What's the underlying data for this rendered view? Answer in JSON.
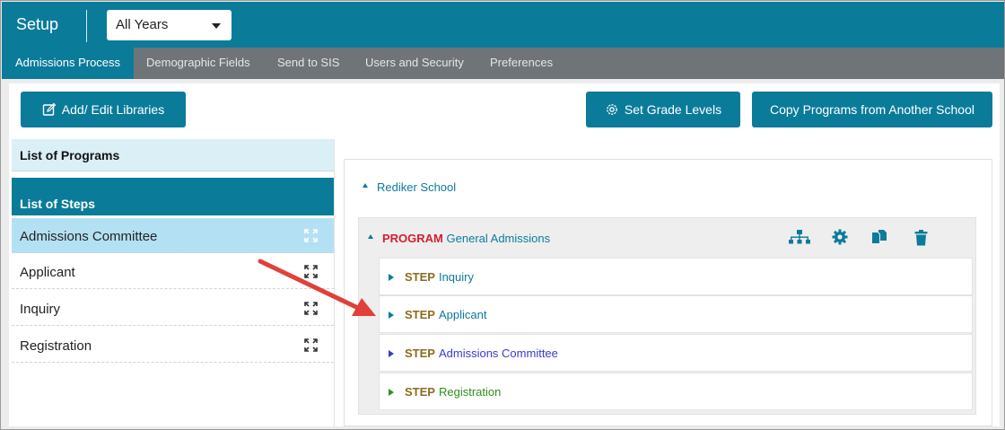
{
  "header": {
    "title": "Setup",
    "year_select": {
      "value": "All Years"
    }
  },
  "tabs": [
    {
      "label": "Admissions Process",
      "active": true
    },
    {
      "label": "Demographic Fields"
    },
    {
      "label": "Send to SIS"
    },
    {
      "label": "Users and Security"
    },
    {
      "label": "Preferences"
    }
  ],
  "toolbar": {
    "add_edit_libraries": "Add/ Edit Libraries",
    "set_grade_levels": "Set Grade Levels",
    "copy_programs": "Copy Programs from Another School"
  },
  "left_panel": {
    "list_of_programs": "List of Programs",
    "list_of_steps": "List of Steps",
    "steps": [
      {
        "label": "Admissions Committee",
        "selected": true
      },
      {
        "label": "Applicant"
      },
      {
        "label": "Inquiry"
      },
      {
        "label": "Registration"
      }
    ]
  },
  "tree": {
    "school": "Rediker School",
    "program": {
      "keyword": "PROGRAM",
      "name": "General Admissions"
    },
    "step_keyword": "STEP",
    "steps": [
      {
        "name": "Inquiry",
        "color": "#0b7b9a"
      },
      {
        "name": "Applicant",
        "color": "#0b7b9a"
      },
      {
        "name": "Admissions Committee",
        "color": "#3a3ad0"
      },
      {
        "name": "Registration",
        "color": "#2e8f1e"
      }
    ]
  },
  "colors": {
    "brand": "#0b7b9a",
    "tab_bar": "#6f7478",
    "program_keyword": "#d21f2f",
    "step_keyword": "#8b6c1e",
    "annotation_arrow": "#e2403a"
  }
}
